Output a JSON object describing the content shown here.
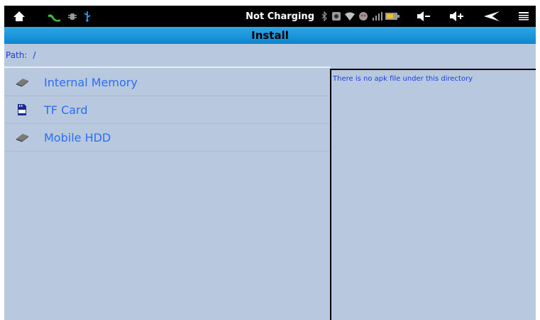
{
  "status_bar": {
    "charging_text": "Not Charging",
    "icons": [
      "home-icon",
      "app-notification-icon",
      "debug-icon",
      "usb-icon",
      "bluetooth-icon",
      "screenshot-icon",
      "wifi-icon",
      "game-icon",
      "signal-icon",
      "battery-icon",
      "volume-down-icon",
      "volume-up-icon",
      "back-icon",
      "menu-icon"
    ]
  },
  "title_bar": {
    "title": "Install"
  },
  "path": {
    "label": "Path:",
    "value": "/"
  },
  "list": {
    "items": [
      {
        "label": "Internal Memory",
        "icon": "drive-icon"
      },
      {
        "label": "TF Card",
        "icon": "sd-card-icon"
      },
      {
        "label": "Mobile HDD",
        "icon": "drive-icon"
      }
    ]
  },
  "right_panel": {
    "message": "There is no apk file under this directory"
  },
  "colors": {
    "status_bar_bg": "#000000",
    "title_bar_bg": "#1b96dc",
    "content_bg": "#b8c9df",
    "item_text": "#2a6ef2",
    "path_text": "#1a3fd9"
  }
}
